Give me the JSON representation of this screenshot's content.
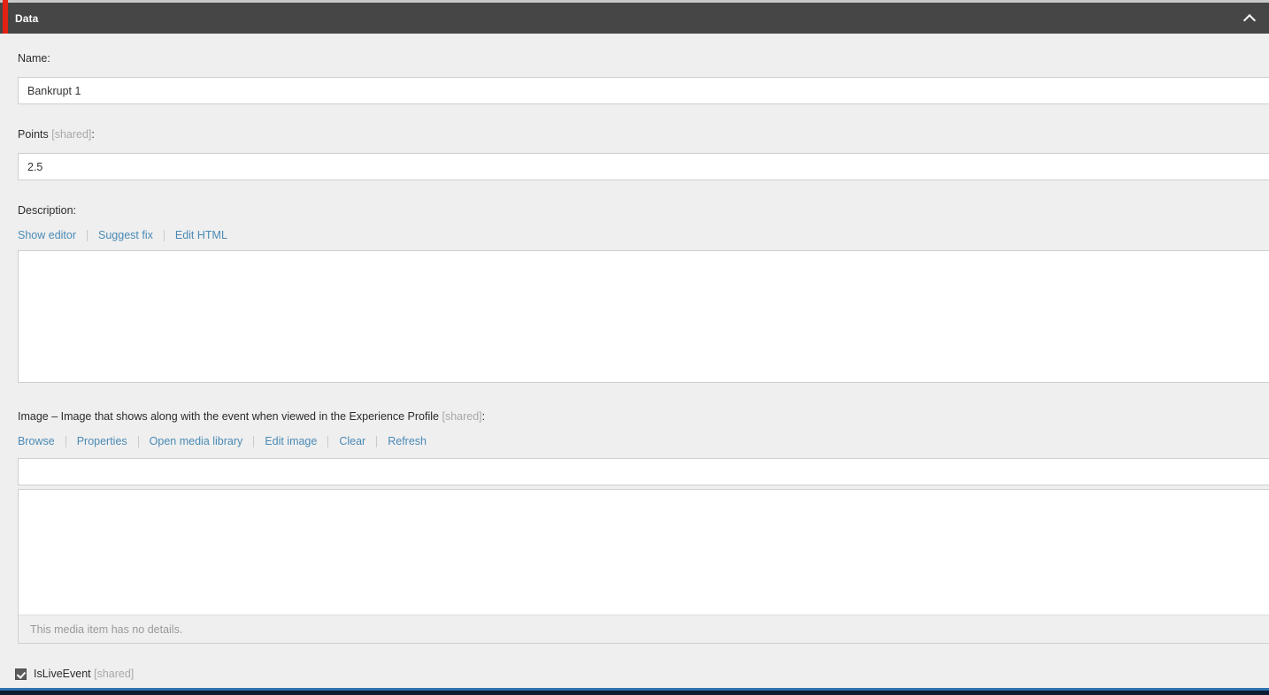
{
  "panel": {
    "title": "Data",
    "collapse_icon": "chevron-up-icon",
    "accent_color": "#e32213",
    "header_bg": "#464646"
  },
  "fields": {
    "name": {
      "label": "Name:",
      "value": "Bankrupt 1",
      "placeholder": ""
    },
    "points": {
      "label": "Points",
      "shared_tag": "[shared]",
      "label_suffix": ":",
      "value": "2.5",
      "placeholder": ""
    },
    "description": {
      "label": "Description:",
      "value": "",
      "links": [
        {
          "label": "Show editor",
          "name": "show-editor-link"
        },
        {
          "label": "Suggest fix",
          "name": "suggest-fix-link"
        },
        {
          "label": "Edit HTML",
          "name": "edit-html-link"
        }
      ]
    },
    "image": {
      "label": "Image – Image that shows along with the event when viewed in the Experience Profile",
      "shared_tag": "[shared]",
      "label_suffix": ":",
      "value": "",
      "placeholder": "",
      "links": [
        {
          "label": "Browse",
          "name": "browse-link"
        },
        {
          "label": "Properties",
          "name": "properties-link"
        },
        {
          "label": "Open media library",
          "name": "open-media-library-link"
        },
        {
          "label": "Edit image",
          "name": "edit-image-link"
        },
        {
          "label": "Clear",
          "name": "clear-link"
        },
        {
          "label": "Refresh",
          "name": "refresh-link"
        }
      ],
      "details_placeholder": "This media item has no details."
    },
    "is_live_event": {
      "label": "IsLiveEvent",
      "shared_tag": "[shared]",
      "checked": true
    }
  },
  "colors": {
    "link": "#4a8ab5",
    "accent_red": "#e32213",
    "bottom_rule": "#2e72ad",
    "bottom_bar": "#0b1c33",
    "muted_text": "#a8a8a8"
  }
}
